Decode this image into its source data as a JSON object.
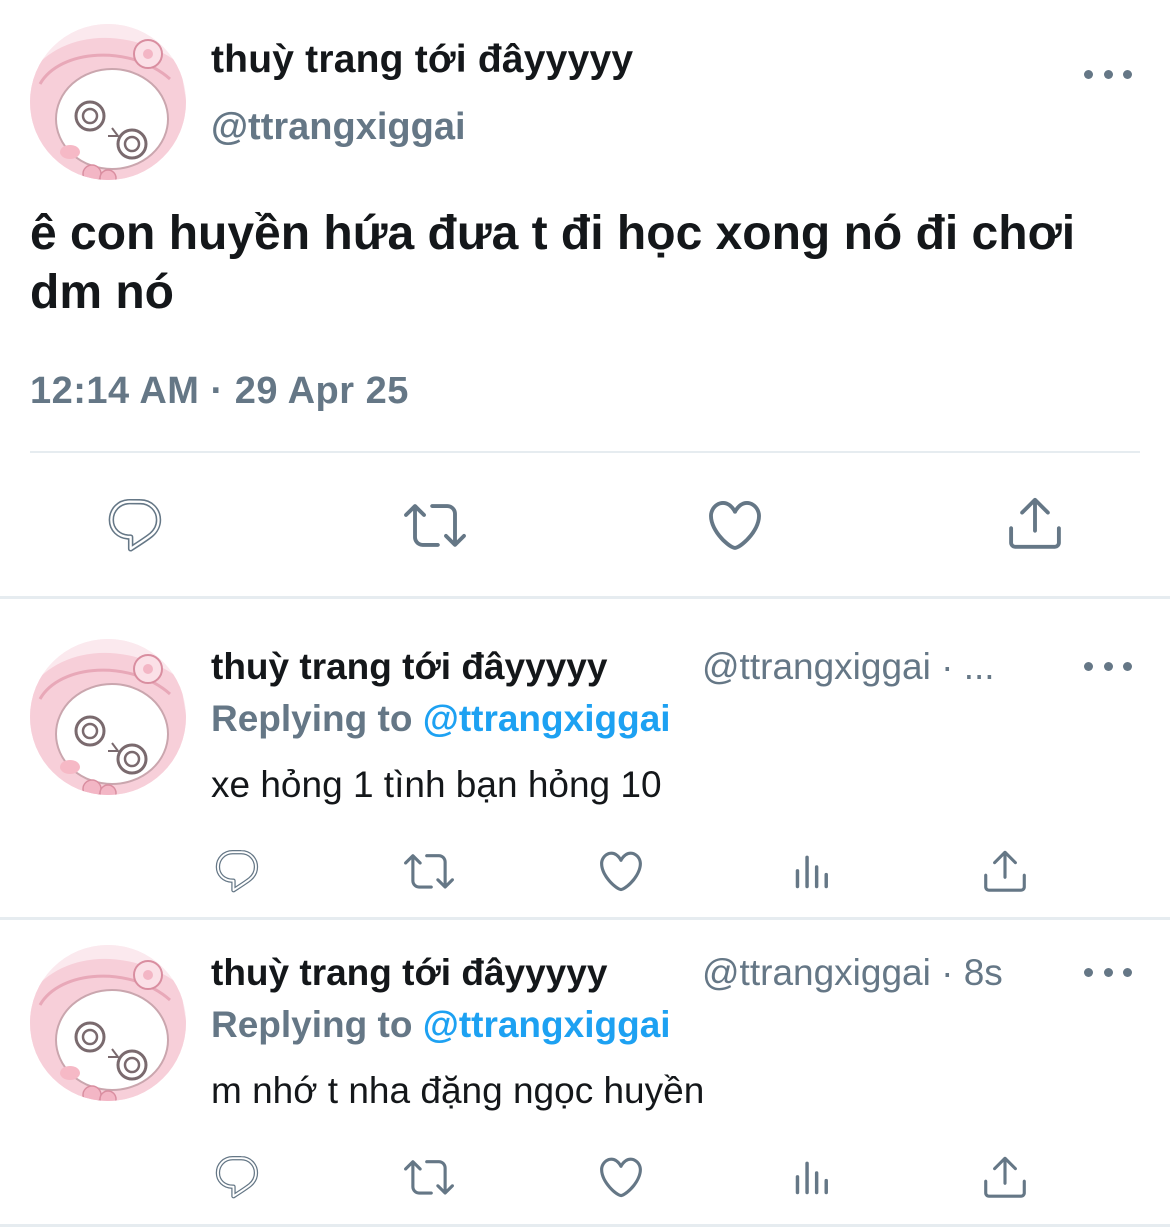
{
  "main_tweet": {
    "display_name": "thuỳ trang tới đâyyyyy",
    "handle": "@ttrangxiggai",
    "text": "ê con huyền hứa đưa t đi học xong nó đi chơi dm nó",
    "timestamp": "12:14 AM · 29 Apr 25",
    "actions": [
      "reply-icon",
      "retweet-icon",
      "like-icon",
      "share-icon"
    ]
  },
  "replies": [
    {
      "display_name": "thuỳ trang tới đâyyyyy",
      "handle_meta": "@ttrangxiggai · ...",
      "replying_prefix": "Replying to",
      "replying_mention": "@ttrangxiggai",
      "text": "xe hỏng 1 tình bạn hỏng 10",
      "actions": [
        "reply-icon",
        "retweet-icon",
        "like-icon",
        "analytics-icon",
        "share-icon"
      ]
    },
    {
      "display_name": "thuỳ trang tới đâyyyyy",
      "handle_meta": "@ttrangxiggai · 8s",
      "replying_prefix": "Replying to",
      "replying_mention": "@ttrangxiggai",
      "text": "m nhớ t nha đặng ngọc huyền",
      "actions": [
        "reply-icon",
        "retweet-icon",
        "like-icon",
        "analytics-icon",
        "share-icon"
      ]
    }
  ],
  "colors": {
    "text": "#14171a",
    "secondary": "#657786",
    "link": "#1da1f2",
    "divider": "#e6ecf0"
  }
}
